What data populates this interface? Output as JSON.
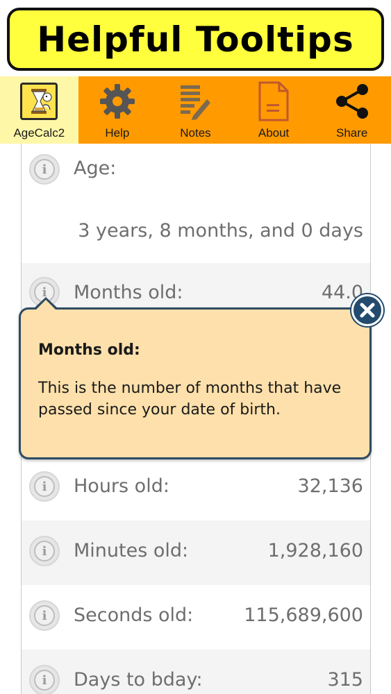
{
  "banner": {
    "title": "Helpful Tooltips"
  },
  "toolbar": {
    "items": [
      {
        "label": "AgeCalc2",
        "icon": "app-logo-icon"
      },
      {
        "label": "Help",
        "icon": "gear-icon"
      },
      {
        "label": "Notes",
        "icon": "notes-icon"
      },
      {
        "label": "About",
        "icon": "document-icon"
      },
      {
        "label": "Share",
        "icon": "share-icon"
      }
    ]
  },
  "age": {
    "label": "Age:",
    "value": "3 years, 8 months, and 0 days"
  },
  "rows": [
    {
      "label": "Months old:",
      "value": "44.0"
    },
    {
      "label": "Hours old:",
      "value": "32,136"
    },
    {
      "label": "Minutes old:",
      "value": "1,928,160"
    },
    {
      "label": "Seconds old:",
      "value": "115,689,600"
    },
    {
      "label": "Days to bday:",
      "value": "315"
    }
  ],
  "tooltip": {
    "title": "Months old:",
    "body": "This is the number of months that have passed since your date of birth."
  },
  "colors": {
    "banner": "#ffff3d",
    "toolbar": "#ff9a00",
    "toolbar_active": "#fff7a8",
    "tooltip_bg": "#fde0ab",
    "tooltip_border": "#2f4a63"
  }
}
